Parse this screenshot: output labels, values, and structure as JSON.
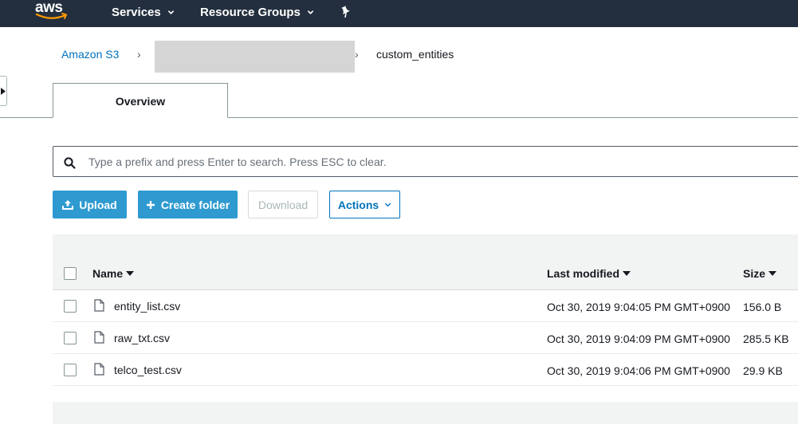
{
  "topnav": {
    "logo_text": "aws",
    "services_label": "Services",
    "resource_groups_label": "Resource Groups",
    "background_color": "#232f3e",
    "logo_smile_color": "#ff9900"
  },
  "breadcrumb": {
    "root_label": "Amazon S3",
    "current_label": "custom_entities",
    "separator": "›"
  },
  "tabs": [
    {
      "label": "Overview",
      "selected": true
    }
  ],
  "search": {
    "placeholder": "Type a prefix and press Enter to search. Press ESC to clear.",
    "value": ""
  },
  "toolbar": {
    "upload_label": "Upload",
    "create_folder_label": "Create folder",
    "download_label": "Download",
    "actions_label": "Actions",
    "primary_color": "#2e9ad0",
    "link_color": "#0073bb"
  },
  "table": {
    "columns": {
      "name": "Name",
      "last_modified": "Last modified",
      "size": "Size"
    },
    "rows": [
      {
        "name": "entity_list.csv",
        "last_modified": "Oct 30, 2019 9:04:05 PM GMT+0900",
        "size": "156.0 B",
        "checked": false
      },
      {
        "name": "raw_txt.csv",
        "last_modified": "Oct 30, 2019 9:04:09 PM GMT+0900",
        "size": "285.5 KB",
        "checked": false
      },
      {
        "name": "telco_test.csv",
        "last_modified": "Oct 30, 2019 9:04:06 PM GMT+0900",
        "size": "29.9 KB",
        "checked": false
      }
    ]
  }
}
